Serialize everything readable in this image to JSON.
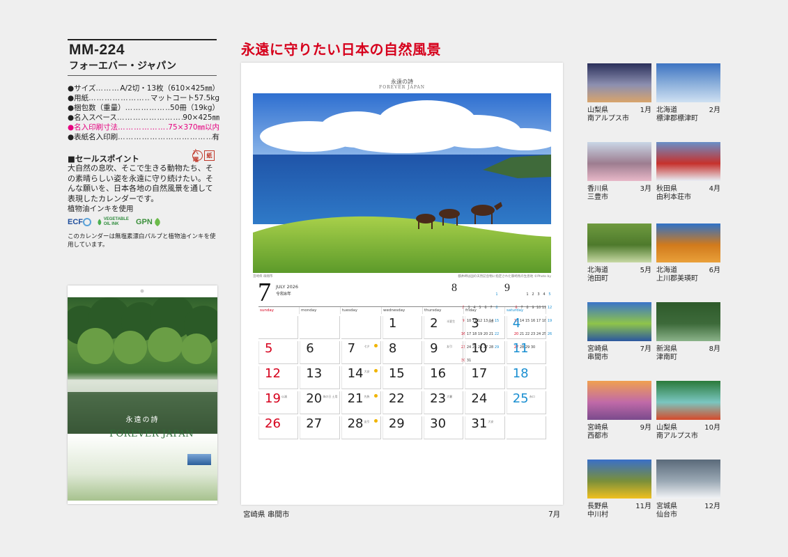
{
  "product": {
    "model": "MM-224",
    "name": "フォーエバー・ジャパン",
    "specs": [
      {
        "label": "●サイズ",
        "value": "A/2切・13枚（610×425㎜）",
        "highlight": false
      },
      {
        "label": "●用紙",
        "value": "マットコート57.5kg",
        "highlight": false
      },
      {
        "label": "●梱包数（重量）",
        "value": "50冊（19kg）",
        "highlight": false
      },
      {
        "label": "●名入スペース",
        "value": "90×425㎜",
        "highlight": false
      },
      {
        "label": "●名入印刷寸法",
        "value": "75×370㎜以内",
        "highlight": true
      },
      {
        "label": "●表紙名入印刷",
        "value": "有",
        "highlight": false
      }
    ],
    "sales_heading": "■セールスポイント",
    "badges": [
      "六曜",
      "紙"
    ],
    "sales_text": "大自然の息吹、そこで生きる動物たち、その素晴らしい姿を永遠に守り続けたい。そんな願いを、日本各地の自然風景を通して表現したカレンダーです。",
    "ink_note": "植物油インキを使用",
    "logos": [
      "ECF",
      "VEGETABLE OIL INK",
      "GPN"
    ],
    "paper_note": "このカレンダーは無塩素漂白パルプと植物油インキを使用しています。"
  },
  "cover": {
    "title": "永遠の詩",
    "brand": "FOREVER JAPAN"
  },
  "main": {
    "title": "永遠に守りたい日本の自然風景",
    "logo_jp": "永遠の詩",
    "logo_en": "FOREVER JAPAN",
    "photo_caption_left": "宮崎県 串間市",
    "photo_caption_right": "都井岬は国の天然記念物に指定された御崎馬の生息地 ©Photo by",
    "month": {
      "number": "7",
      "english": "JULY 2026",
      "era": "令和8年"
    },
    "mini_months": [
      {
        "num": "8",
        "days": [
          "",
          "",
          "",
          "",
          "",
          "",
          "1",
          "2",
          "3",
          "4",
          "5",
          "6",
          "7",
          "8",
          "9",
          "10",
          "11",
          "12",
          "13",
          "14",
          "15",
          "16",
          "17",
          "18",
          "19",
          "20",
          "21",
          "22",
          "23",
          "24",
          "25",
          "26",
          "27",
          "28",
          "29",
          "30",
          "31"
        ]
      },
      {
        "num": "9",
        "days": [
          "",
          "",
          "1",
          "2",
          "3",
          "4",
          "5",
          "6",
          "7",
          "8",
          "9",
          "10",
          "11",
          "12",
          "13",
          "14",
          "15",
          "16",
          "17",
          "18",
          "19",
          "20",
          "21",
          "22",
          "23",
          "24",
          "25",
          "26",
          "27",
          "28",
          "29",
          "30"
        ]
      }
    ],
    "weekdays": [
      "sunday",
      "monday",
      "tuesday",
      "wednesday",
      "thursday",
      "friday",
      "saturday"
    ],
    "days": [
      {
        "d": "",
        "n": ""
      },
      {
        "d": "",
        "n": ""
      },
      {
        "d": "",
        "n": ""
      },
      {
        "d": "1",
        "n": ""
      },
      {
        "d": "2",
        "n": "半夏生"
      },
      {
        "d": "3",
        "n": "先勝"
      },
      {
        "d": "4",
        "n": ""
      },
      {
        "d": "5",
        "n": ""
      },
      {
        "d": "6",
        "n": ""
      },
      {
        "d": "7",
        "n": "七夕"
      },
      {
        "d": "8",
        "n": ""
      },
      {
        "d": "9",
        "n": "友引"
      },
      {
        "d": "10",
        "n": ""
      },
      {
        "d": "11",
        "n": ""
      },
      {
        "d": "12",
        "n": ""
      },
      {
        "d": "13",
        "n": ""
      },
      {
        "d": "14",
        "n": "大安"
      },
      {
        "d": "15",
        "n": ""
      },
      {
        "d": "16",
        "n": ""
      },
      {
        "d": "17",
        "n": ""
      },
      {
        "d": "18",
        "n": ""
      },
      {
        "d": "19",
        "n": "仏滅"
      },
      {
        "d": "20",
        "n": "海の日 土用"
      },
      {
        "d": "21",
        "n": "先負"
      },
      {
        "d": "22",
        "n": ""
      },
      {
        "d": "23",
        "n": "大暑"
      },
      {
        "d": "24",
        "n": ""
      },
      {
        "d": "25",
        "n": "赤口"
      },
      {
        "d": "26",
        "n": ""
      },
      {
        "d": "27",
        "n": ""
      },
      {
        "d": "28",
        "n": "友引"
      },
      {
        "d": "29",
        "n": ""
      },
      {
        "d": "30",
        "n": ""
      },
      {
        "d": "31",
        "n": "大安"
      },
      {
        "d": "",
        "n": ""
      }
    ],
    "caption_left": "宮崎県 串間市",
    "caption_right": "7月"
  },
  "thumbnails": [
    {
      "pref": "山梨県",
      "city": "南アルプス市",
      "month": "1月",
      "colors": [
        "#2a2f5a",
        "#d9a46b",
        "#8c8fb0"
      ]
    },
    {
      "pref": "北海道",
      "city": "標津郡標津町",
      "month": "2月",
      "colors": [
        "#3d74c2",
        "#cfe0f2",
        "#8fb2dc"
      ]
    },
    {
      "pref": "香川県",
      "city": "三豊市",
      "month": "3月",
      "colors": [
        "#c9d6e6",
        "#e8b8c8",
        "#9d7d90"
      ]
    },
    {
      "pref": "秋田県",
      "city": "由利本荘市",
      "month": "4月",
      "colors": [
        "#6a8fc8",
        "#e8eef5",
        "#c6312c"
      ]
    },
    {
      "pref": "北海道",
      "city": "池田町",
      "month": "5月",
      "colors": [
        "#6f9a3f",
        "#c7d9a4",
        "#4e7a2c"
      ]
    },
    {
      "pref": "北海道",
      "city": "上川郡美瑛町",
      "month": "6月",
      "colors": [
        "#2f72c8",
        "#e9a03a",
        "#d17a1c"
      ]
    },
    {
      "pref": "宮崎県",
      "city": "串間市",
      "month": "7月",
      "colors": [
        "#3a74c9",
        "#2b57a0",
        "#8fc44a"
      ]
    },
    {
      "pref": "新潟県",
      "city": "津南町",
      "month": "8月",
      "colors": [
        "#2e5a2a",
        "#8bb38a",
        "#3d6a3a"
      ]
    },
    {
      "pref": "宮崎県",
      "city": "西都市",
      "month": "9月",
      "colors": [
        "#f0a050",
        "#7a4a8c",
        "#c06aa8"
      ]
    },
    {
      "pref": "山梨県",
      "city": "南アルプス市",
      "month": "10月",
      "colors": [
        "#2a7a3a",
        "#d64a2a",
        "#7ac6c0"
      ]
    },
    {
      "pref": "長野県",
      "city": "中川村",
      "month": "11月",
      "colors": [
        "#3a6fc8",
        "#f0c020",
        "#7a8f3a"
      ]
    },
    {
      "pref": "宮城県",
      "city": "仙台市",
      "month": "12月",
      "colors": [
        "#5a6a7a",
        "#f2f4f6",
        "#9aa8b4"
      ]
    }
  ]
}
